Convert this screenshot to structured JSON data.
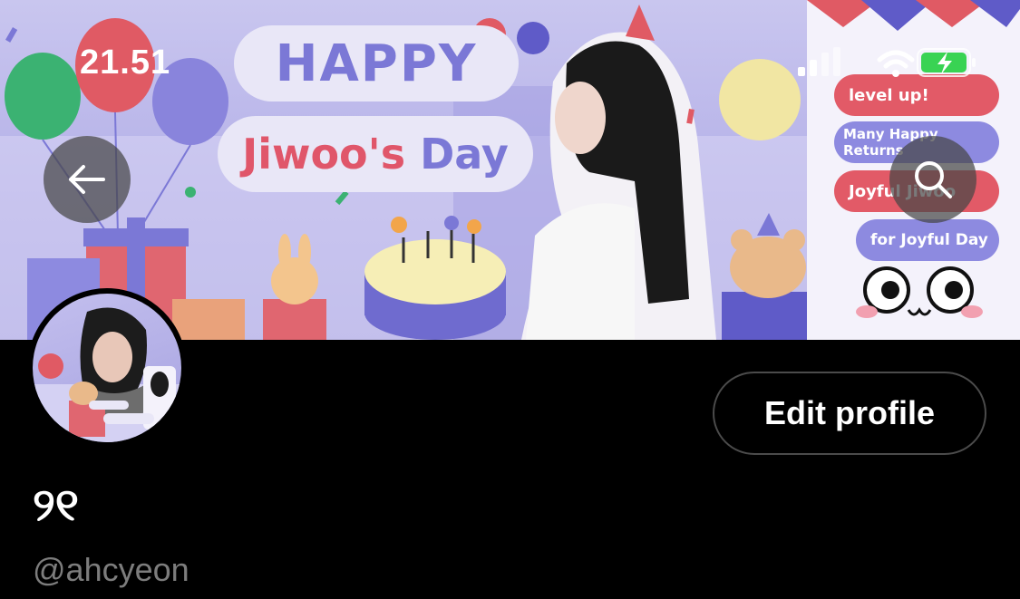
{
  "status_bar": {
    "time": "21.51"
  },
  "banner": {
    "line1": "HAPPY",
    "line2a": "Jiwoo's",
    "line2b": "Day",
    "tags": [
      "level up!",
      "Many Happy Returns",
      "Joyful Jiwoo",
      "for Joyful Day"
    ],
    "colors": {
      "red": "#e25a67",
      "purple": "#8d8ae0",
      "lavender": "#b5b1e8"
    }
  },
  "nav": {
    "back_icon": "back-arrow-icon",
    "search_icon": "search-icon"
  },
  "profile": {
    "edit_label": "Edit profile",
    "display_name": "୨୧",
    "handle": "@ahcyeon"
  }
}
